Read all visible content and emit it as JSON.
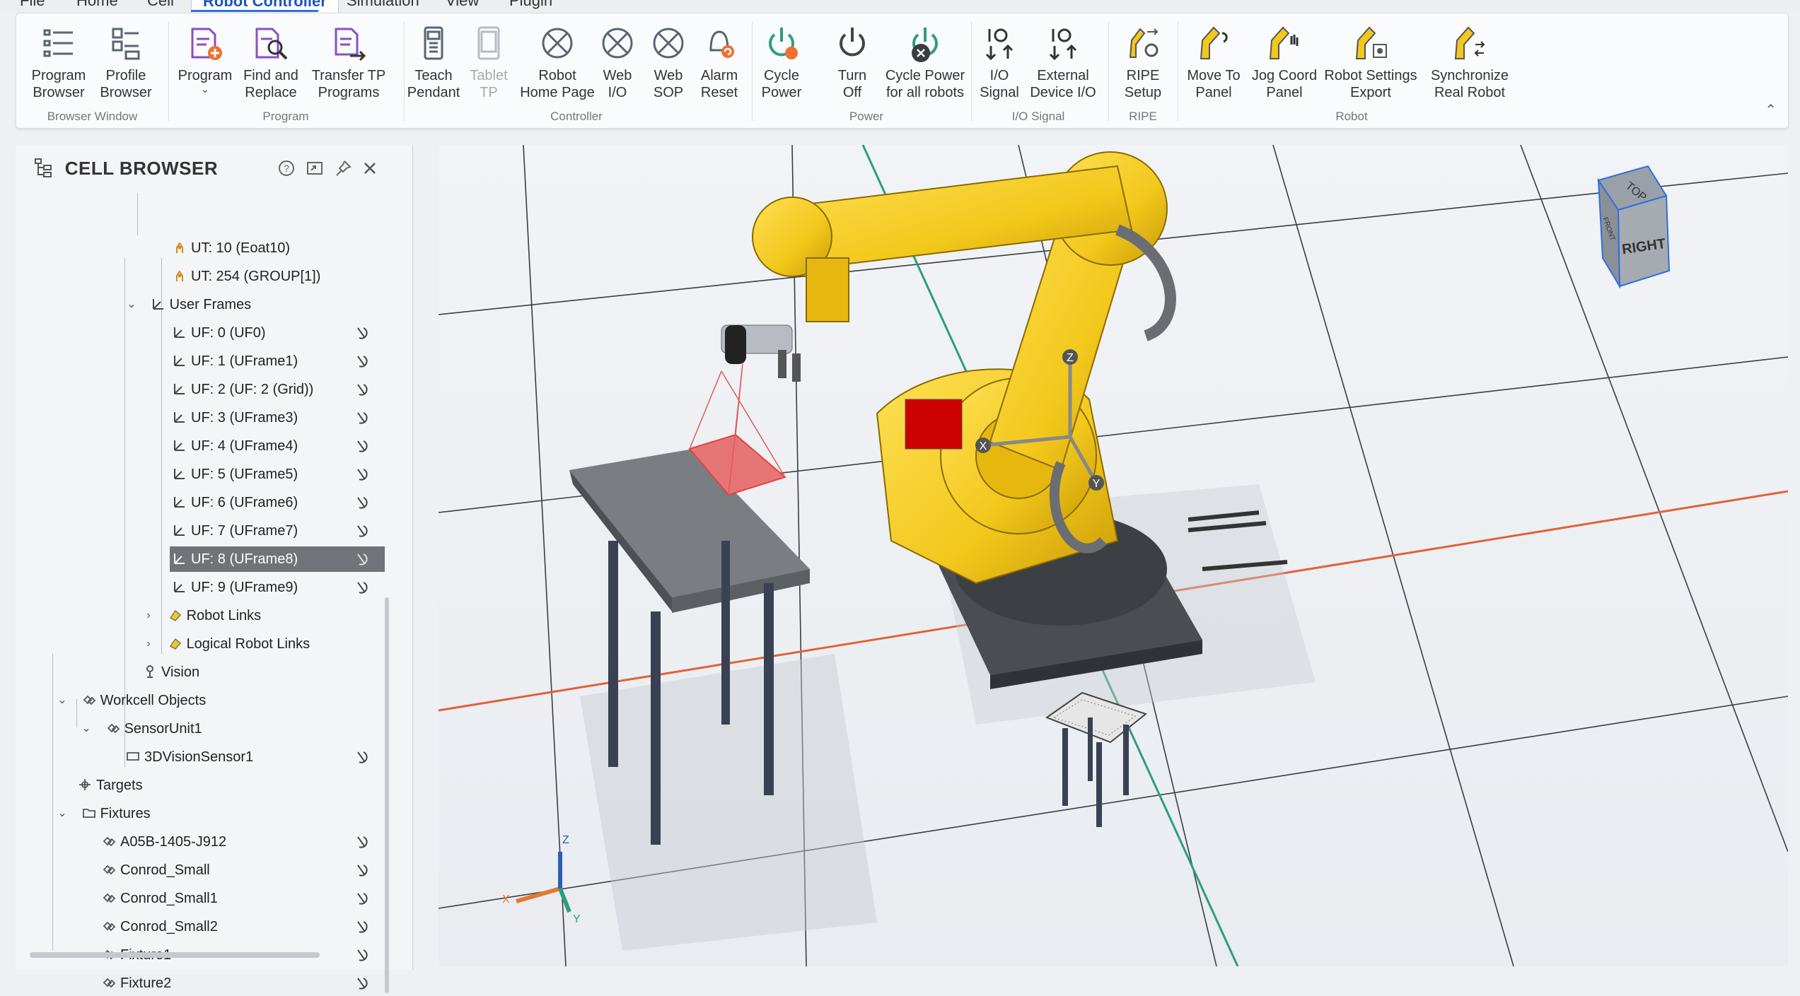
{
  "menu": {
    "tabs": [
      "File",
      "Home",
      "Cell",
      "Robot Controller",
      "Simulation",
      "View",
      "Plugin"
    ],
    "active_tab": "Robot Controller"
  },
  "ribbon": {
    "groups": {
      "browser_window": "Browser Window",
      "program": "Program",
      "controller": "Controller",
      "power": "Power",
      "io_signal": "I/O Signal",
      "ripe": "RIPE",
      "robot": "Robot"
    },
    "buttons": {
      "program_browser": "Program\nBrowser",
      "profile_browser": "Profile\nBrowser",
      "program": "Program",
      "find_replace": "Find and\nReplace",
      "transfer_tp": "Transfer TP\nPrograms",
      "teach_pendant": "Teach\nPendant",
      "tablet_tp": "Tablet\nTP",
      "robot_home": "Robot\nHome Page",
      "web_io": "Web\nI/O",
      "web_sop": "Web\nSOP",
      "alarm_reset": "Alarm\nReset",
      "cycle_power": "Cycle\nPower",
      "turn_off": "Turn\nOff",
      "cycle_power_all": "Cycle Power\nfor all robots",
      "io_signal": "I/O\nSignal",
      "external_io": "External\nDevice I/O",
      "ripe_setup": "RIPE\nSetup",
      "move_to_panel": "Move To\nPanel",
      "jog_coord": "Jog Coord\nPanel",
      "robot_settings_export": "Robot Settings\nExport",
      "sync_real_robot": "Synchronize\nReal Robot"
    }
  },
  "cell_browser": {
    "title": "CELL BROWSER",
    "items": {
      "ut10": "UT: 10  (Eoat10)",
      "ut254": "UT: 254  (GROUP[1])",
      "user_frames": "User Frames",
      "uf0": "UF: 0 (UF0)",
      "uf1": "UF: 1 (UFrame1)",
      "uf2": "UF: 2 (UF: 2 (Grid))",
      "uf3": "UF: 3 (UFrame3)",
      "uf4": "UF: 4 (UFrame4)",
      "uf5": "UF: 5 (UFrame5)",
      "uf6": "UF: 6 (UFrame6)",
      "uf7": "UF: 7 (UFrame7)",
      "uf8": "UF: 8 (UFrame8)",
      "uf9": "UF: 9 (UFrame9)",
      "robot_links": "Robot Links",
      "logical_robot_links": "Logical Robot Links",
      "vision": "Vision",
      "workcell_objects": "Workcell Objects",
      "sensor_unit": "SensorUnit1",
      "vision_sensor": "3DVisionSensor1",
      "targets": "Targets",
      "fixtures": "Fixtures",
      "fx_a05b": "A05B-1405-J912",
      "fx_conrod_small": "Conrod_Small",
      "fx_conrod_small1": "Conrod_Small1",
      "fx_conrod_small2": "Conrod_Small2",
      "fx_fixture1": "Fixture1",
      "fx_fixture2": "Fixture2"
    },
    "selected": "UF: 8 (UFrame8)"
  },
  "viewport": {
    "view_cube": {
      "top": "TOP",
      "right": "RIGHT",
      "front": "FRONT"
    },
    "axes": {
      "x": "X",
      "y": "Y",
      "z": "Z"
    },
    "world_axes": {
      "x": "X",
      "y": "Y",
      "z": "Z"
    }
  },
  "colors": {
    "robot_yellow": "#f2c81c",
    "grid_red": "#e0623a",
    "grid_green": "#2e9e7a",
    "selection": "#707378",
    "accent": "#2f6fe0"
  }
}
